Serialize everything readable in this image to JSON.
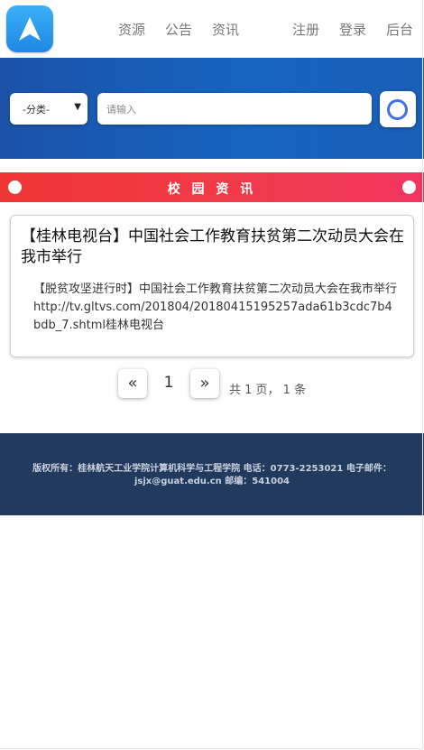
{
  "nav": {
    "links": [
      "资源",
      "公告",
      "资讯",
      "注册",
      "登录",
      "后台"
    ]
  },
  "search": {
    "category_value": "-分类-",
    "placeholder": "请输入"
  },
  "section": {
    "title": "校 园 资 讯"
  },
  "news": {
    "title": "【桂林电视台】中国社会工作教育扶贫第二次动员大会在我市举行",
    "summary": "【脱贫攻坚进行时】中国社会工作教育扶贫第二次动员大会在我市举行http://tv.gltvs.com/201804/20180415195257ada61b3cdc7b4bdb_7.shtml桂林电视台"
  },
  "pagination": {
    "prev": "«",
    "current": "1",
    "next": "»",
    "total": "共 1 页， 1 条"
  },
  "footer": {
    "text": "版权所有：桂林航天工业学院计算机科学与工程学院 电话：0773-2253021 电子邮件：jsjx@guat.edu.cn 邮编：541004"
  },
  "colors": {
    "header_band": "#1565c0",
    "section_bar": "#f03a46",
    "footer": "#223a5e"
  }
}
